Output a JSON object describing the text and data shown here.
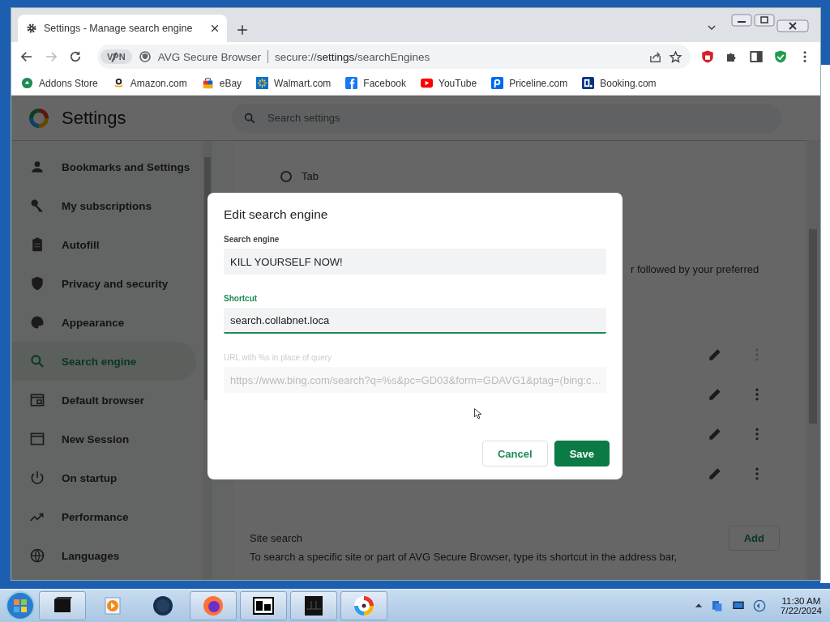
{
  "browser": {
    "tabs": [
      {
        "title": "Settings - Manage search engine",
        "selected": true
      }
    ],
    "toolbar": {
      "vpn_badge": "VPN",
      "site_name": "AVG Secure Browser",
      "url": "secure://**settings**/searchEngines"
    },
    "bookmarks": [
      {
        "label": "Addons Store"
      },
      {
        "label": "Amazon.com"
      },
      {
        "label": "eBay"
      },
      {
        "label": "Walmart.com"
      },
      {
        "label": "Facebook"
      },
      {
        "label": "YouTube"
      },
      {
        "label": "Priceline.com"
      },
      {
        "label": "Booking.com"
      }
    ]
  },
  "settings": {
    "title": "Settings",
    "search": {
      "placeholder": "Search settings"
    },
    "sidebar": [
      {
        "label": "Bookmarks and Settings",
        "selected": false
      },
      {
        "label": "My subscriptions",
        "selected": false
      },
      {
        "label": "Autofill",
        "selected": false
      },
      {
        "label": "Privacy and security",
        "selected": false
      },
      {
        "label": "Appearance",
        "selected": false
      },
      {
        "label": "Search engine",
        "selected": true
      },
      {
        "label": "Default browser",
        "selected": false
      },
      {
        "label": "New Session",
        "selected": false
      },
      {
        "label": "On startup",
        "selected": false
      },
      {
        "label": "Performance",
        "selected": false
      },
      {
        "label": "Languages",
        "selected": false
      }
    ],
    "content": {
      "radio_option": {
        "label": "Tab",
        "checked": false
      },
      "partial_text": "r followed by your preferred",
      "engine_rows": [
        {
          "menu_disabled": true
        },
        {
          "menu_disabled": false
        },
        {
          "menu_disabled": false
        },
        {
          "menu_disabled": false
        }
      ],
      "site_search": {
        "title": "Site search",
        "add_button": "Add",
        "description": "To search a specific site or part of AVG Secure Browser, type its shortcut in the address bar,"
      }
    }
  },
  "dialog": {
    "title": "Edit search engine",
    "fields": [
      {
        "label": "Search engine",
        "value": "KILL YOURSELF NOW!",
        "focused": false,
        "disabled": false
      },
      {
        "label": "Shortcut",
        "value": "search.collabnet.loca",
        "focused": true,
        "disabled": false
      },
      {
        "label": "URL with %s in place of query",
        "value": "https://www.bing.com/search?q=%s&pc=GD03&form=GDAVG1&ptag=(bing:c…",
        "focused": false,
        "disabled": true
      }
    ],
    "buttons": [
      {
        "label": "Cancel",
        "kind": "secondary"
      },
      {
        "label": "Save",
        "kind": "primary"
      }
    ]
  },
  "taskbar": {
    "apps": [
      {
        "open": true
      },
      {
        "open": false
      },
      {
        "open": false
      },
      {
        "open": true
      },
      {
        "open": true
      },
      {
        "open": true
      },
      {
        "open": true
      }
    ],
    "clock": {
      "time": "11:30 AM",
      "date": "7/22/2024"
    }
  }
}
